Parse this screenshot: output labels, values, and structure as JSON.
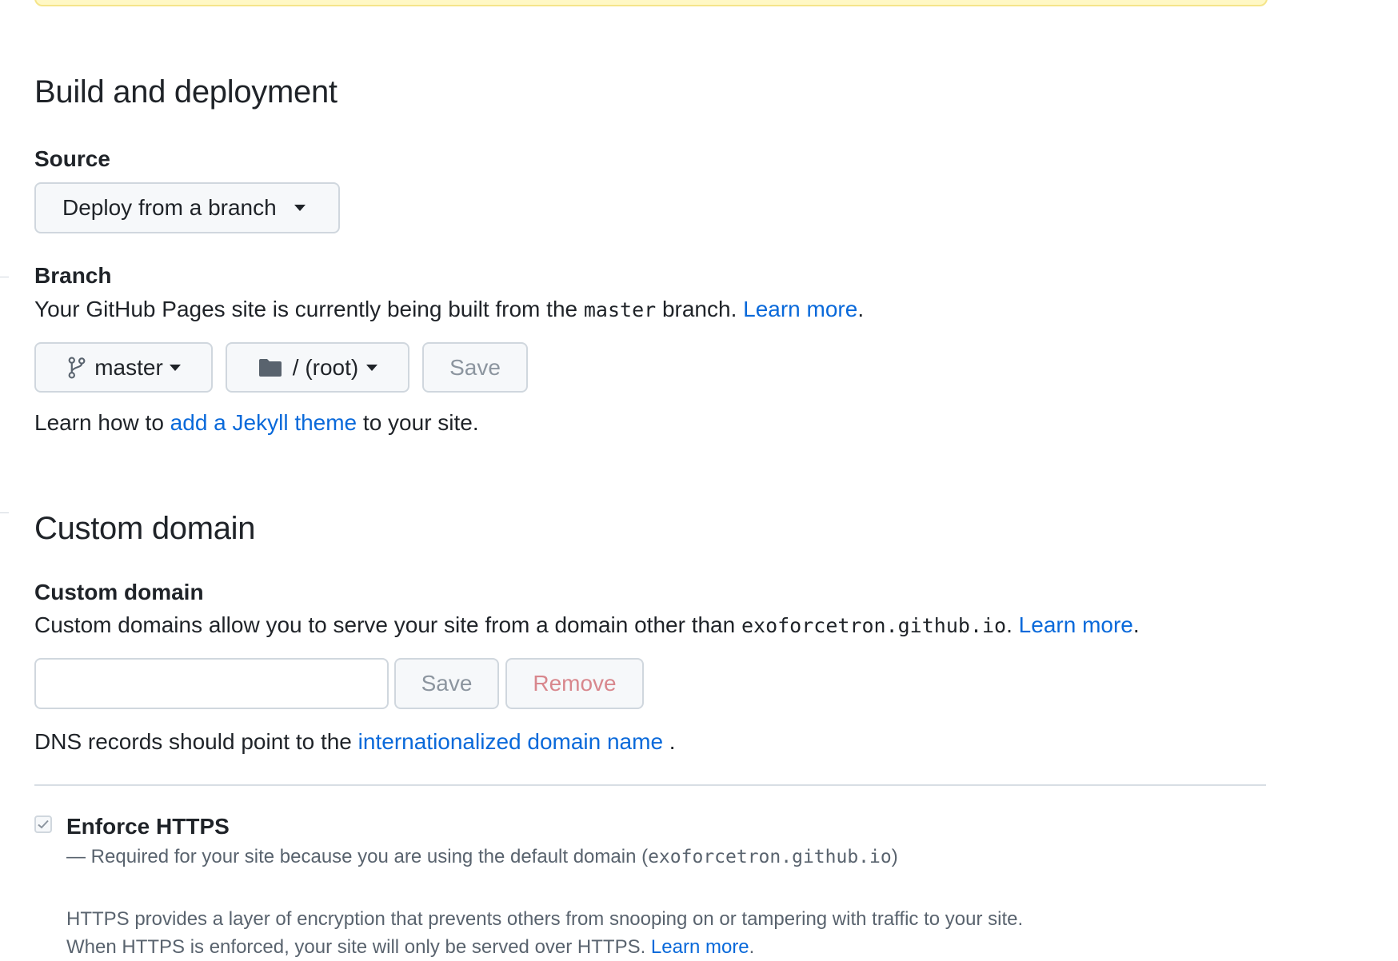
{
  "build": {
    "heading": "Build and deployment",
    "source_label": "Source",
    "source_select": "Deploy from a branch",
    "branch_label": "Branch",
    "branch_desc_pre": "Your GitHub Pages site is currently being built from the ",
    "branch_desc_code": "master",
    "branch_desc_post": " branch. ",
    "branch_learn_more": "Learn more",
    "branch_desc_end": ".",
    "branch_select": "master",
    "folder_select": "/ (root)",
    "save_label": "Save",
    "jekyll_pre": "Learn how to ",
    "jekyll_link": "add a Jekyll theme",
    "jekyll_post": " to your site."
  },
  "custom_domain": {
    "heading": "Custom domain",
    "label": "Custom domain",
    "desc_pre": "Custom domains allow you to serve your site from a domain other than ",
    "desc_code": "exoforcetron.github.io",
    "desc_mid": ". ",
    "learn_more": "Learn more",
    "desc_end": ".",
    "input_value": "",
    "save_label": "Save",
    "remove_label": "Remove",
    "dns_pre": "DNS records should point to the ",
    "dns_link": "internationalized domain name",
    "dns_post": " ."
  },
  "https": {
    "label": "Enforce HTTPS",
    "checked": true,
    "required_pre": "— Required for your site because you are using the default domain (",
    "required_code": "exoforcetron.github.io",
    "required_post": ")",
    "info_line1": "HTTPS provides a layer of encryption that prevents others from snooping on or tampering with traffic to your site.",
    "info_line2_pre": "When HTTPS is enforced, your site will only be served over HTTPS. ",
    "info_learn_more": "Learn more",
    "info_line2_end": "."
  },
  "colors": {
    "link": "#0969da",
    "text": "#1f2328",
    "muted": "#59636e",
    "border": "#d0d7de",
    "button_bg": "#f6f8fa",
    "danger_disabled": "#d8878d",
    "warning_border": "#f5e58a"
  }
}
